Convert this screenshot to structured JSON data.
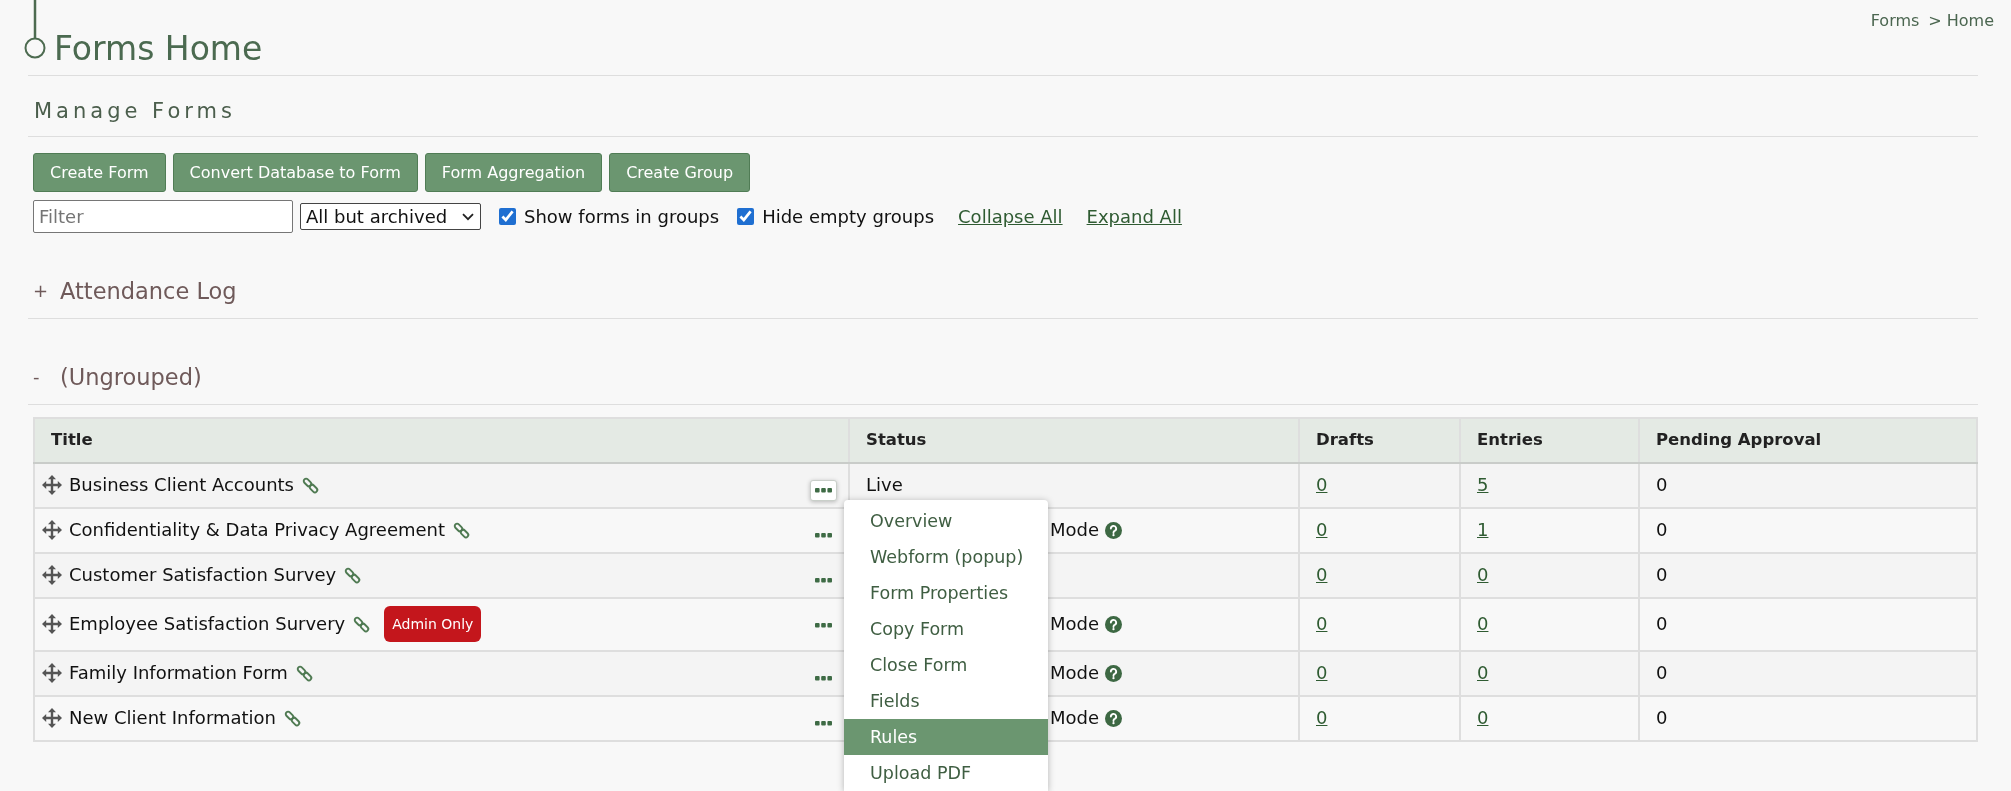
{
  "header": {
    "title": "Forms Home",
    "breadcrumb": [
      {
        "label": "Forms"
      },
      {
        "label": "Home"
      }
    ],
    "breadcrumb_separator": ">"
  },
  "section": {
    "title": "Manage Forms"
  },
  "toolbar": {
    "buttons": [
      {
        "label": "Create Form"
      },
      {
        "label": "Convert Database to Form"
      },
      {
        "label": "Form Aggregation"
      },
      {
        "label": "Create Group"
      }
    ]
  },
  "filters": {
    "search": {
      "placeholder": "Filter"
    },
    "dropdown": {
      "value": "All but archived"
    },
    "checkboxes": [
      {
        "label": "Show forms in groups",
        "checked": true
      },
      {
        "label": "Hide empty groups",
        "checked": true
      }
    ],
    "links": [
      {
        "label": "Collapse All"
      },
      {
        "label": "Expand All"
      }
    ]
  },
  "groups": [
    {
      "toggle": "+",
      "name": "Attendance Log"
    },
    {
      "toggle": "-",
      "name": "(Ungrouped)",
      "table": {
        "columns": [
          "Title",
          "Status",
          "Drafts",
          "Entries",
          "Pending Approval"
        ],
        "rows": [
          {
            "title": "Business Client Accounts",
            "status": "Live",
            "status_help": false,
            "drafts": "0",
            "entries": "5",
            "pending_approval": "0",
            "menu_open": true
          },
          {
            "title": "Confidentiality & Data Privacy Agreement",
            "status": "Mode",
            "status_help": true,
            "drafts": "0",
            "entries": "1",
            "pending_approval": "0",
            "menu_open": false
          },
          {
            "title": "Customer Satisfaction Survey",
            "status_help": false,
            "drafts": "0",
            "entries": "0",
            "pending_approval": "0",
            "menu_open": false
          },
          {
            "title": "Employee Satisfaction Survery",
            "badge": "Admin Only",
            "status": "Mode",
            "status_help": true,
            "drafts": "0",
            "entries": "0",
            "pending_approval": "0",
            "menu_open": false
          },
          {
            "title": "Family Information Form",
            "status": "Mode",
            "status_help": true,
            "drafts": "0",
            "entries": "0",
            "pending_approval": "0",
            "menu_open": false
          },
          {
            "title": "New Client Information",
            "status": "Mode",
            "status_help": true,
            "drafts": "0",
            "entries": "0",
            "pending_approval": "0",
            "menu_open": false
          }
        ],
        "row_menu": {
          "items": [
            {
              "label": "Overview",
              "selected": false
            },
            {
              "label": "Webform (popup)",
              "selected": false
            },
            {
              "label": "Form Properties",
              "selected": false
            },
            {
              "label": "Copy Form",
              "selected": false
            },
            {
              "label": "Close Form",
              "selected": false
            },
            {
              "label": "Fields",
              "selected": false
            },
            {
              "label": "Rules",
              "selected": true
            },
            {
              "label": "Upload PDF",
              "selected": false
            }
          ]
        }
      }
    }
  ]
}
